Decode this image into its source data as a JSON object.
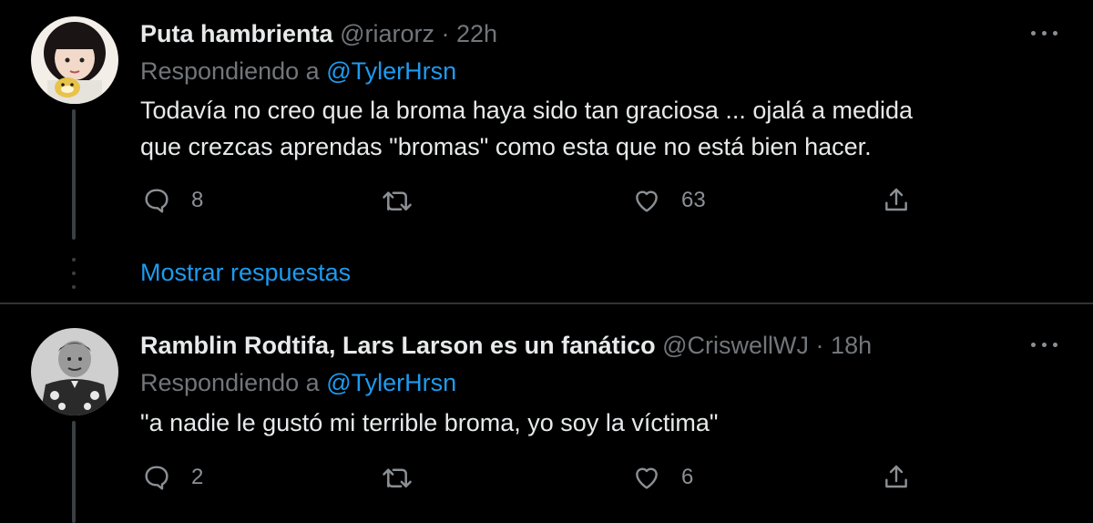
{
  "colors": {
    "background": "#000000",
    "accent": "#1d9bf0",
    "muted": "#71767b",
    "text": "#e7e9ea"
  },
  "tweets": [
    {
      "display_name": "Puta hambrienta",
      "handle": "@riarorz",
      "separator": "·",
      "time": "22h",
      "replying_prefix": "Respondiendo a",
      "replying_to": "@TylerHrsn",
      "text_lines": [
        "Todavía no creo que la broma haya sido tan graciosa ... ojalá a medida",
        "que crezcas aprendas \"bromas\" como esta que no está bien hacer."
      ],
      "replies": "8",
      "retweets": "",
      "likes": "63",
      "show_replies": "Mostrar respuestas",
      "icons": {
        "more": "more-icon",
        "reply": "reply-icon",
        "retweet": "retweet-icon",
        "like": "like-icon",
        "share": "share-icon"
      }
    },
    {
      "display_name": "Ramblin Rodtifa, Lars Larson es un fanático",
      "handle": "@CriswellWJ",
      "separator": "·",
      "time": "18h",
      "replying_prefix": "Respondiendo a",
      "replying_to": "@TylerHrsn",
      "text_lines": [
        "\"a nadie le gustó mi terrible broma, yo soy la víctima\""
      ],
      "replies": "2",
      "retweets": "",
      "likes": "6",
      "icons": {
        "more": "more-icon",
        "reply": "reply-icon",
        "retweet": "retweet-icon",
        "like": "like-icon",
        "share": "share-icon"
      }
    }
  ]
}
